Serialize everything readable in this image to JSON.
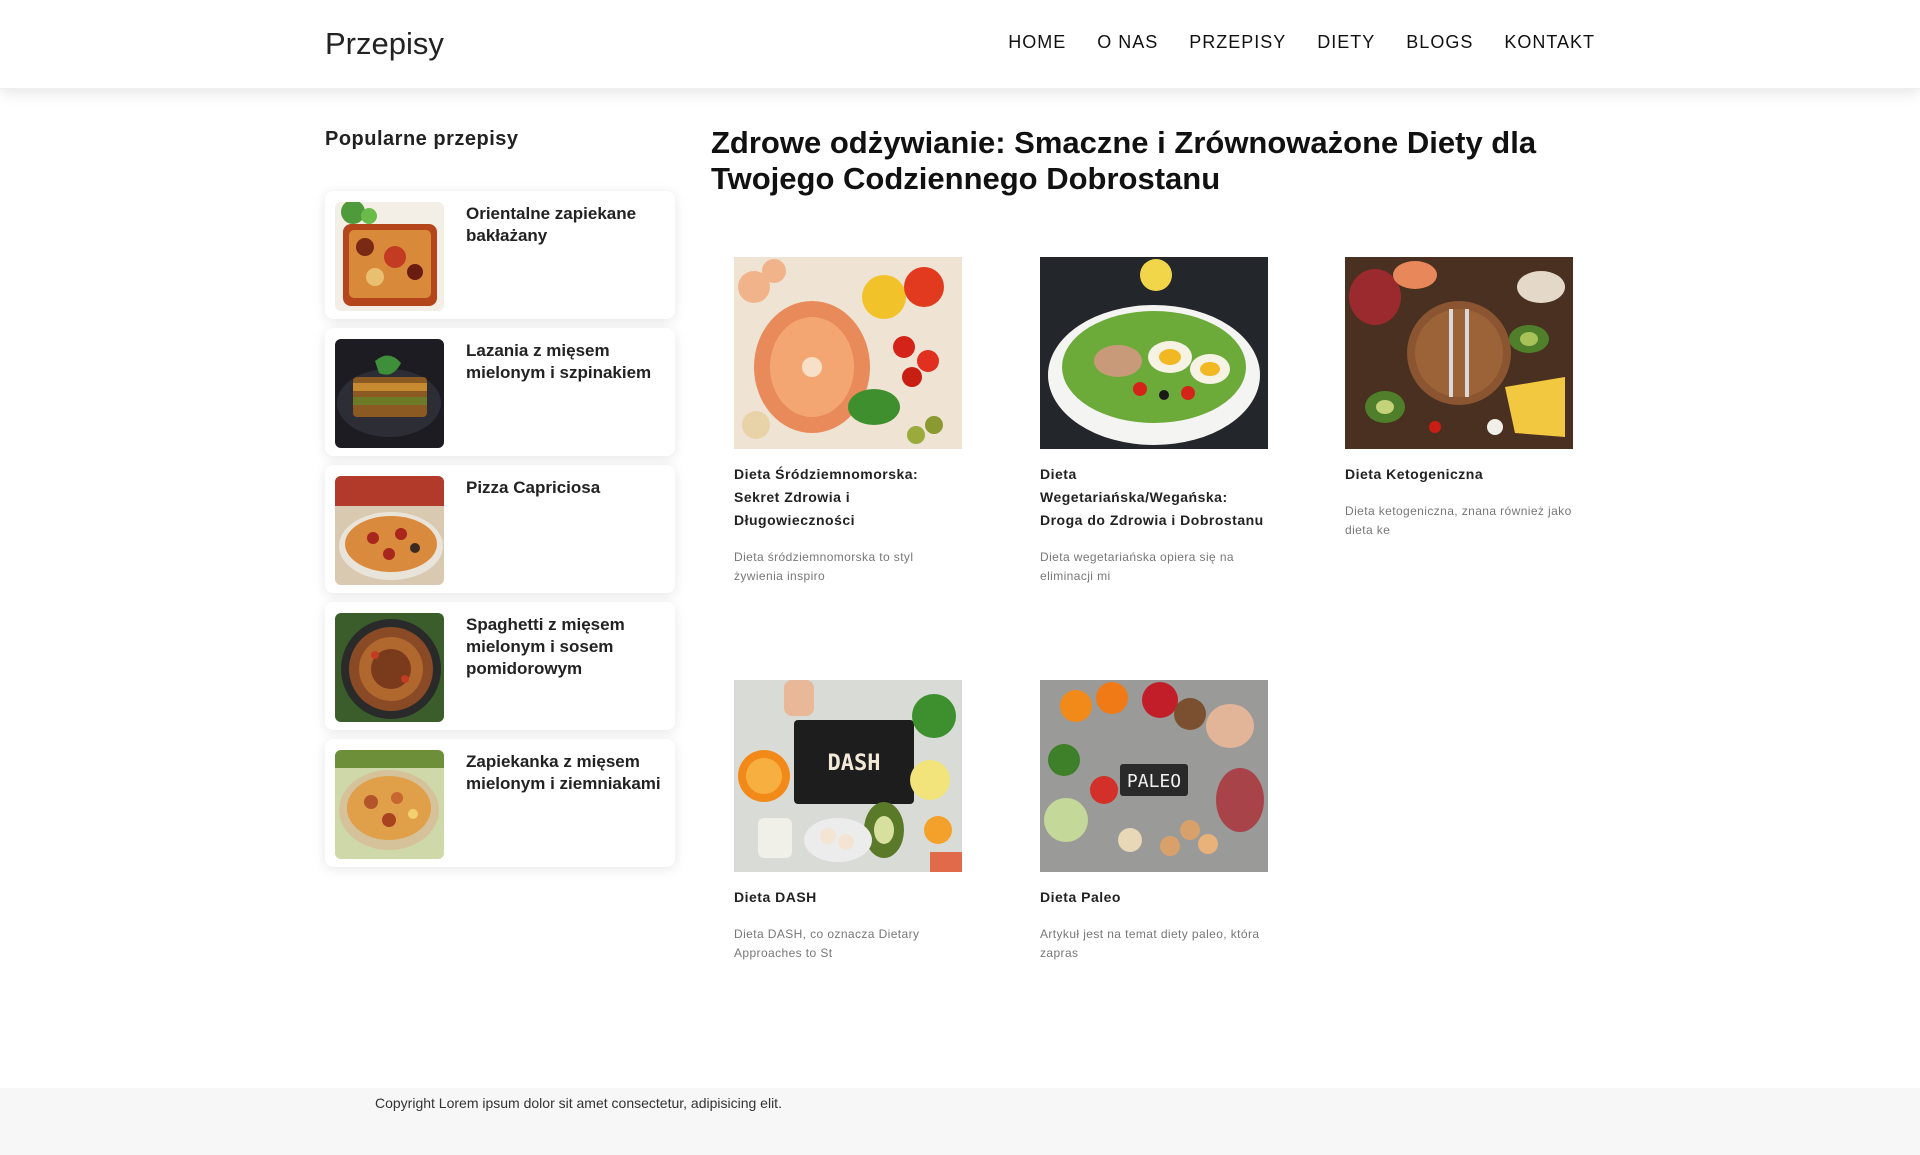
{
  "header": {
    "logo": "Przepisy",
    "nav": [
      "HOME",
      "O NAS",
      "PRZEPISY",
      "DIETY",
      "BLOGS",
      "KONTAKT"
    ]
  },
  "sidebar": {
    "title": "Popularne przepisy",
    "items": [
      {
        "label": "Orientalne zapiekane bakłażany",
        "image": "eggplant-casserole-photo"
      },
      {
        "label": "Lazania z mięsem mielonym i szpinakiem",
        "image": "lasagna-photo"
      },
      {
        "label": "Pizza Capriciosa",
        "image": "pizza-photo"
      },
      {
        "label": "Spaghetti z mięsem mielonym i sosem pomidorowym",
        "image": "spaghetti-photo"
      },
      {
        "label": "Zapiekanka z mięsem mielonym i ziemniakami",
        "image": "potato-casserole-photo"
      }
    ]
  },
  "main": {
    "title": "Zdrowe odżywianie: Smaczne i Zrównoważone Diety dla Twojego Codziennego Dobrostanu",
    "cards": [
      {
        "title": "Dieta Śródziemnomorska: Sekret Zdrowia i Długowieczności",
        "desc": "Dieta śródziemnomorska to styl żywienia inspiro",
        "image": "mediterranean-food-photo"
      },
      {
        "title": "Dieta Wegetariańska/Wegańska: Droga do Zdrowia i Dobrostanu",
        "desc": "Dieta wegetariańska opiera się na eliminacji mi",
        "image": "salad-bowl-photo"
      },
      {
        "title": "Dieta Ketogeniczna",
        "desc": "Dieta ketogeniczna, znana również jako dieta ke",
        "image": "keto-food-photo"
      },
      {
        "title": "Dieta DASH",
        "desc": "Dieta DASH, co oznacza Dietary Approaches to St",
        "image": "dash-diet-photo",
        "sign": "DASH"
      },
      {
        "title": "Dieta Paleo",
        "desc": "Artykuł jest na temat diety paleo, która zapras",
        "image": "paleo-food-photo",
        "sign": "PALEO"
      }
    ]
  },
  "footer": {
    "text": "Copyright Lorem ipsum dolor sit amet consectetur, adipisicing elit."
  }
}
